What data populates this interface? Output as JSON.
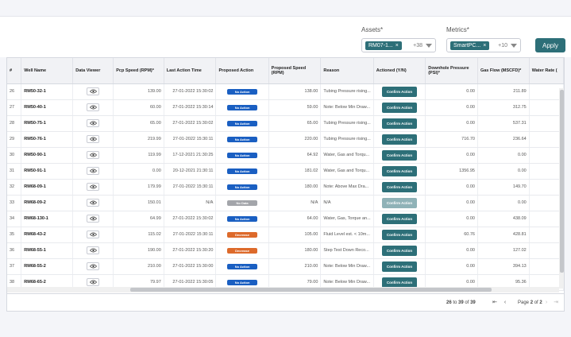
{
  "filters": {
    "assets_label": "Assets*",
    "assets_chip": "RM07-1...",
    "assets_more": "+38",
    "metrics_label": "Metrics*",
    "metrics_chip": "SmartPC...",
    "metrics_more": "+10",
    "apply_label": "Apply"
  },
  "columns": [
    "#",
    "Well Name",
    "Data Viewer",
    "Pcp Speed (RPM)*",
    "Last Action Time",
    "Proposed Action",
    "Proposed Speed (RPM)",
    "Reason",
    "Actioned (Y/N)",
    "Downhole Pressure (PSI)*",
    "Gas Flow (MSCFD)*",
    "Water Rate ("
  ],
  "rows": [
    {
      "n": "26",
      "well": "RM50-32-1",
      "pcp": "139.00",
      "time": "27-01-2022 15:30:02",
      "action": "No Action",
      "speed": "138.00",
      "reason": "Tubing Pressure rising...",
      "confirm": "Confirm Action",
      "dh": "0.00",
      "gas": "211.89"
    },
    {
      "n": "27",
      "well": "RM50-40-1",
      "pcp": "60.00",
      "time": "27-01-2022 15:30:14",
      "action": "No Action",
      "speed": "59.00",
      "reason": "Note: Below Min Draw...",
      "confirm": "Confirm Action",
      "dh": "0.00",
      "gas": "312.75"
    },
    {
      "n": "28",
      "well": "RM50-75-1",
      "pcp": "65.00",
      "time": "27-01-2022 15:30:02",
      "action": "No Action",
      "speed": "65.00",
      "reason": "Tubing Pressure rising...",
      "confirm": "Confirm Action",
      "dh": "0.00",
      "gas": "537.31"
    },
    {
      "n": "29",
      "well": "RM50-76-1",
      "pcp": "219.99",
      "time": "27-01-2022 15:30:11",
      "action": "No Action",
      "speed": "220.00",
      "reason": "Tubing Pressure rising...",
      "confirm": "Confirm Action",
      "dh": "716.70",
      "gas": "236.64"
    },
    {
      "n": "30",
      "well": "RM50-90-1",
      "pcp": "119.99",
      "time": "17-12-2021 21:30:25",
      "action": "No Action",
      "speed": "64.92",
      "reason": "Water, Gas and Torqu...",
      "confirm": "Confirm Action",
      "dh": "0.00",
      "gas": "0.00"
    },
    {
      "n": "31",
      "well": "RM50-91-1",
      "pcp": "0.00",
      "time": "20-12-2021 21:30:11",
      "action": "No Action",
      "speed": "181.02",
      "reason": "Water, Gas and Torqu...",
      "confirm": "Confirm Action",
      "dh": "1356.95",
      "gas": "0.00"
    },
    {
      "n": "32",
      "well": "RM68-09-1",
      "pcp": "179.99",
      "time": "27-01-2022 15:30:11",
      "action": "No Action",
      "speed": "180.00",
      "reason": "Note: Above Max Dra...",
      "confirm": "Confirm Action",
      "dh": "0.00",
      "gas": "149.70"
    },
    {
      "n": "33",
      "well": "RM68-09-2",
      "pcp": "150.01",
      "time": "N/A",
      "action": "No Data",
      "speed": "N/A",
      "reason": "N/A",
      "confirm": "Confirm Action",
      "dh": "0.00",
      "gas": "0.00"
    },
    {
      "n": "34",
      "well": "RM68-130-1",
      "pcp": "64.99",
      "time": "27-01-2022 15:30:02",
      "action": "No Action",
      "speed": "64.00",
      "reason": "Water, Gas, Torque an...",
      "confirm": "Confirm Action",
      "dh": "0.00",
      "gas": "438.09"
    },
    {
      "n": "35",
      "well": "RM68-43-2",
      "pcp": "115.02",
      "time": "27-01-2022 15:30:11",
      "action": "Decrease",
      "speed": "105.00",
      "reason": "Fluid Level est. < 10m...",
      "confirm": "Confirm Action",
      "dh": "60.76",
      "gas": "428.81"
    },
    {
      "n": "36",
      "well": "RM68-55-1",
      "pcp": "190.00",
      "time": "27-01-2022 15:30:20",
      "action": "Decrease",
      "speed": "180.00",
      "reason": "Step Test Down Reco...",
      "confirm": "Confirm Action",
      "dh": "0.00",
      "gas": "127.02"
    },
    {
      "n": "37",
      "well": "RM68-55-2",
      "pcp": "210.00",
      "time": "27-01-2022 15:30:00",
      "action": "No Action",
      "speed": "210.00",
      "reason": "Note: Below Min Draw...",
      "confirm": "Confirm Action",
      "dh": "0.00",
      "gas": "394.13"
    },
    {
      "n": "38",
      "well": "RM68-65-2",
      "pcp": "79.97",
      "time": "27-01-2022 15:30:05",
      "action": "No Action",
      "speed": "79.00",
      "reason": "Note: Below Min Draw...",
      "confirm": "Confirm Action",
      "dh": "0.00",
      "gas": "95.36"
    }
  ],
  "pagination": {
    "from": "26",
    "to_word": "to",
    "to": "39",
    "of_word": "of",
    "total": "39",
    "page_word": "Page",
    "page": "2",
    "of_word2": "of",
    "pages": "2"
  }
}
